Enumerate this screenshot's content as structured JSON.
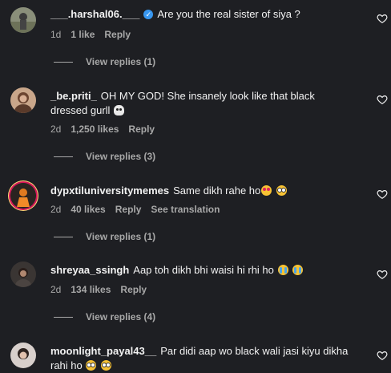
{
  "comments": [
    {
      "username": "___.harshal06.___",
      "verified": true,
      "text": "Are you the real sister of siya ?",
      "time": "1d",
      "likes": "1 like",
      "reply": "Reply",
      "view_replies": "View replies (1)"
    },
    {
      "username": "_be.priti_",
      "text": "OH MY GOD! She insanely look like that black",
      "text2": "dressed gurll",
      "emoji": "skull",
      "time": "2d",
      "likes": "1,250 likes",
      "reply": "Reply",
      "view_replies": "View replies (3)"
    },
    {
      "username": "dypxtiluniversitymemes",
      "text": "Same dikh rahe ho",
      "emojis": [
        "smiling-face-with-heart-eyes",
        "flushed-face"
      ],
      "time": "2d",
      "likes": "40 likes",
      "reply": "Reply",
      "see_translation": "See translation",
      "view_replies": "View replies (1)"
    },
    {
      "username": "shreyaa_ssingh",
      "text": "Aap toh dikh bhi waisi hi rhi ho",
      "emojis": [
        "loudly-crying-face",
        "loudly-crying-face"
      ],
      "time": "2d",
      "likes": "134 likes",
      "reply": "Reply",
      "view_replies": "View replies (4)"
    },
    {
      "username": "moonlight_payal43__",
      "text": "Par didi aap wo black wali jasi kiyu dikha",
      "text2": "rahi ho",
      "emojis": [
        "flushed-face",
        "flushed-face"
      ]
    }
  ],
  "icons": {
    "like": "heart-outline-icon",
    "verified": "verified-badge-icon"
  },
  "colors": {
    "background": "#1e1f23",
    "text": "#f2f2f2",
    "muted": "#a8a8a8",
    "verified": "#3897f0"
  }
}
